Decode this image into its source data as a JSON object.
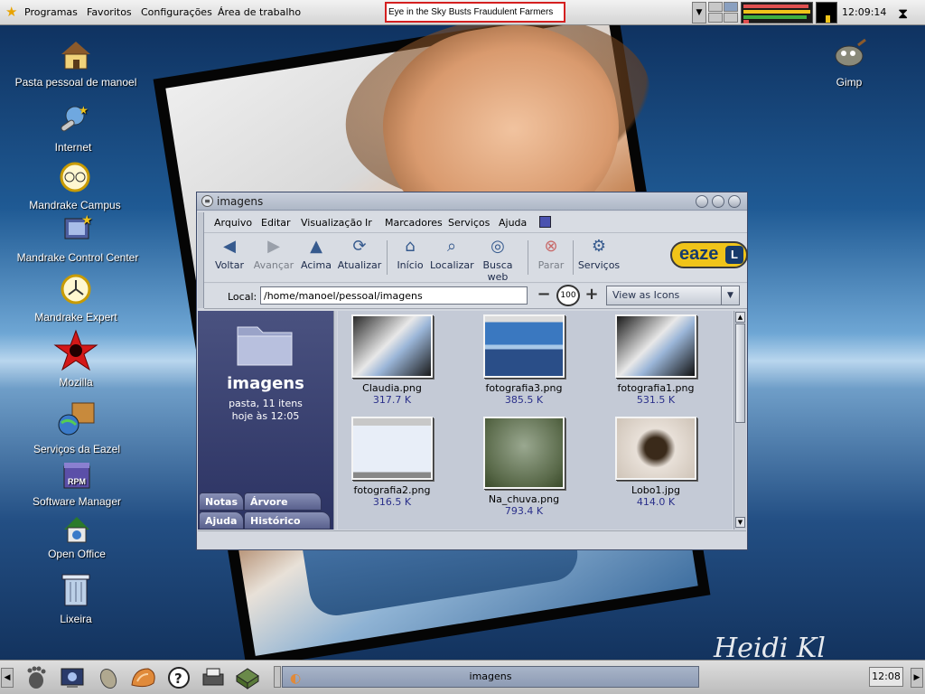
{
  "top_panel": {
    "menus": [
      "Programas",
      "Favoritos",
      "Configurações",
      "Área de trabalho"
    ],
    "ticker": "Eye in the Sky Busts Fraudulent Farmers",
    "clock": "12:09:14"
  },
  "desktop": {
    "icons": [
      {
        "label": "Pasta pessoal de manoel",
        "icon": "home-folder-icon"
      },
      {
        "label": "Internet",
        "icon": "internet-icon"
      },
      {
        "label": "Mandrake Campus",
        "icon": "campus-icon"
      },
      {
        "label": "Mandrake Control Center",
        "icon": "control-center-icon"
      },
      {
        "label": "Mandrake Expert",
        "icon": "expert-icon"
      },
      {
        "label": "Mozilla",
        "icon": "mozilla-icon"
      },
      {
        "label": "Serviços da Eazel",
        "icon": "eazel-services-icon"
      },
      {
        "label": "Software Manager",
        "icon": "rpm-icon"
      },
      {
        "label": "Open Office",
        "icon": "openoffice-icon"
      },
      {
        "label": "Lixeira",
        "icon": "trash-icon"
      },
      {
        "label": "Gimp",
        "icon": "gimp-icon"
      }
    ],
    "signature": "Heidi Kl"
  },
  "window": {
    "title": "imagens",
    "menubar": [
      "Arquivo",
      "Editar",
      "Visualização",
      "Ir",
      "Marcadores",
      "Serviços",
      "Ajuda"
    ],
    "toolbar": [
      {
        "label": "Voltar",
        "icon": "back-arrow-icon",
        "enabled": true
      },
      {
        "label": "Avançar",
        "icon": "forward-arrow-icon",
        "enabled": false
      },
      {
        "label": "Acima",
        "icon": "up-arrow-icon",
        "enabled": true
      },
      {
        "label": "Atualizar",
        "icon": "refresh-icon",
        "enabled": true
      },
      {
        "label": "Início",
        "icon": "home-icon",
        "enabled": true
      },
      {
        "label": "Localizar",
        "icon": "search-icon",
        "enabled": true
      },
      {
        "label": "Busca web",
        "icon": "web-search-icon",
        "enabled": true
      },
      {
        "label": "Parar",
        "icon": "stop-icon",
        "enabled": false
      },
      {
        "label": "Serviços",
        "icon": "services-icon",
        "enabled": true
      }
    ],
    "brand": "eaze",
    "brand_mark": "L",
    "location": {
      "label": "Local:",
      "value": "/home/manoel/pessoal/imagens",
      "zoom": "100",
      "view_mode": "View as Icons"
    },
    "sidebar": {
      "folder_name": "imagens",
      "info_line1": "pasta, 11 itens",
      "info_line2": "hoje às 12:05",
      "tabs": [
        "Notas",
        "Árvore",
        "Ajuda",
        "Histórico"
      ]
    },
    "files": [
      {
        "name": "Claudia.png",
        "size": "317.7 K"
      },
      {
        "name": "fotografia3.png",
        "size": "385.5 K"
      },
      {
        "name": "fotografia1.png",
        "size": "531.5 K"
      },
      {
        "name": "fotografia2.png",
        "size": "316.5 K"
      },
      {
        "name": "Na_chuva.png",
        "size": "793.4 K"
      },
      {
        "name": "Lobo1.jpg",
        "size": "414.0 K"
      }
    ]
  },
  "bottom_panel": {
    "task": "imagens",
    "clock": "12:08"
  },
  "colors": {
    "sidebar": "#3b4372",
    "eazel_yellow": "#f0c419",
    "ticker_border": "#d42020"
  }
}
